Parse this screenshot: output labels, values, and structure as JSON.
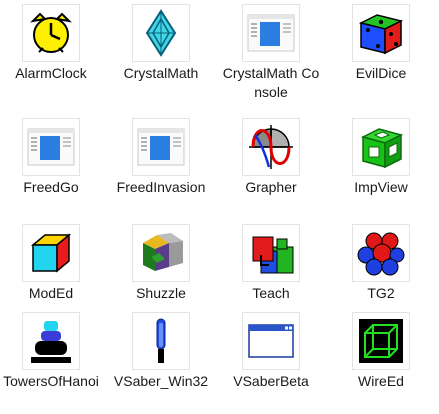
{
  "icons": [
    {
      "label": "AlarmClock",
      "icon": "alarm-clock-icon"
    },
    {
      "label": "CrystalMath",
      "icon": "crystal-icon"
    },
    {
      "label": "CrystalMath Console",
      "icon": "window-app-icon"
    },
    {
      "label": "EvilDice",
      "icon": "dice-icon"
    },
    {
      "label": "FreedGo",
      "icon": "window-app-icon"
    },
    {
      "label": "FreedInvasion",
      "icon": "window-app-icon"
    },
    {
      "label": "Grapher",
      "icon": "grapher-icon"
    },
    {
      "label": "ImpView",
      "icon": "green-cube-icon"
    },
    {
      "label": "ModEd",
      "icon": "color-cube-icon"
    },
    {
      "label": "Shuzzle",
      "icon": "puzzle-cube-icon"
    },
    {
      "label": "Teach",
      "icon": "teach-blocks-icon"
    },
    {
      "label": "TG2",
      "icon": "spheres-icon"
    },
    {
      "label": "TowersOfHanoi",
      "icon": "hanoi-tower-icon"
    },
    {
      "label": "VSaber_Win32",
      "icon": "lightsaber-icon"
    },
    {
      "label": "VSaberBeta",
      "icon": "blank-window-icon"
    },
    {
      "label": "WireEd",
      "icon": "wireframe-cube-icon"
    }
  ]
}
